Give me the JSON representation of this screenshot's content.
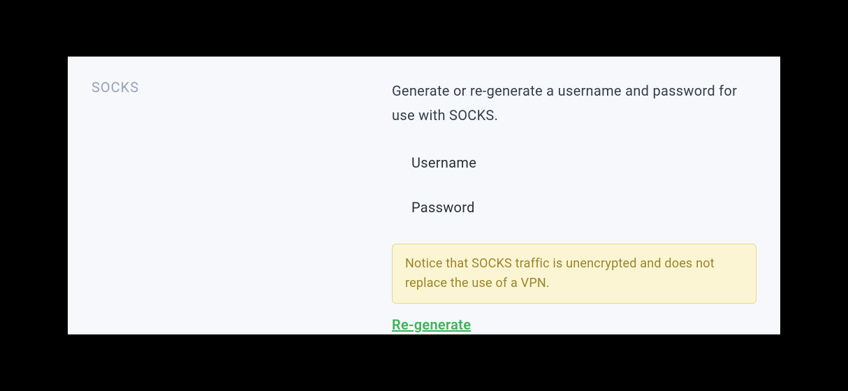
{
  "sidebar": {
    "title": "SOCKS"
  },
  "content": {
    "description": "Generate or re-generate a username and password for use with SOCKS.",
    "fields": {
      "username_label": "Username",
      "password_label": "Password"
    },
    "notice": "Notice that SOCKS traffic is unencrypted and does not replace the use of a VPN.",
    "regenerate_label": "Re-generate"
  }
}
